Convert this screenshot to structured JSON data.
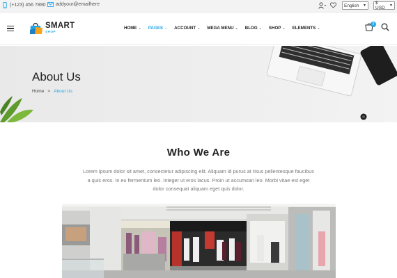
{
  "topbar": {
    "phone": "(+123) 456 7890",
    "email": "addyour@emailhere",
    "language": "English",
    "currency": "$ USD"
  },
  "brand": {
    "name": "SMART",
    "tagline": "SHOP",
    "accent": "#22a6e6"
  },
  "nav": {
    "items": [
      {
        "label": "HOME"
      },
      {
        "label": "PAGES"
      },
      {
        "label": "ACCOUNT"
      },
      {
        "label": "MEGA MENU"
      },
      {
        "label": "BLOG"
      },
      {
        "label": "SHOP"
      },
      {
        "label": "ELEMENTS"
      }
    ],
    "active_index": 1
  },
  "cart": {
    "count": "0"
  },
  "hero": {
    "title": "About Us",
    "breadcrumb": {
      "home": "Home",
      "separator": ">",
      "current": "About Us"
    }
  },
  "about": {
    "heading": "Who We Are",
    "text": "Lorem ipsum dolor sit amet, consectetur adipiscing elit. Aliquam id purus at risus pellentesque faucibus a quis eros. In eu fermentum leo. Integer ut eros lacus. Proin ut accumsan leo. Morbi vitae est eget dolor consequat aliquam eget quis dolor."
  },
  "icons": {
    "phone": "phone-icon",
    "mail": "mail-icon",
    "user": "user-icon",
    "wishlist": "heart-icon",
    "menu": "hamburger-icon",
    "cart": "cart-icon",
    "search": "search-icon"
  }
}
